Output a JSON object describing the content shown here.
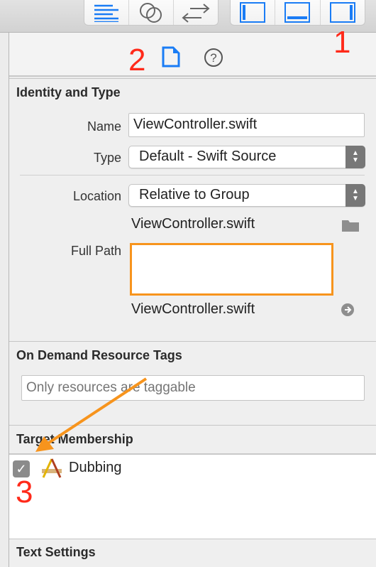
{
  "toolbar": {
    "editor_icons": [
      "align-left-icon",
      "venn-icon",
      "arrows-icon"
    ],
    "panel_icons": [
      "left-panel-icon",
      "bottom-panel-icon",
      "right-panel-icon"
    ]
  },
  "inspector_tabs": [
    "file-inspector-icon",
    "help-icon"
  ],
  "identity": {
    "title": "Identity and Type",
    "name_label": "Name",
    "name_value": "ViewController.swift",
    "type_label": "Type",
    "type_value": "Default - Swift Source",
    "location_label": "Location",
    "location_value": "Relative to Group",
    "location_file": "ViewController.swift",
    "fullpath_label": "Full Path",
    "fullpath_file": "ViewController.swift"
  },
  "odr": {
    "title": "On Demand Resource Tags",
    "placeholder": "Only resources are taggable"
  },
  "target": {
    "title": "Target Membership",
    "items": [
      {
        "label": "Dubbing",
        "checked": true
      }
    ]
  },
  "text_settings": {
    "title": "Text Settings"
  },
  "annotations": {
    "n1": "1",
    "n2": "2",
    "n3": "3",
    "color_red": "#ff2a1a",
    "color_orange": "#f7941d"
  },
  "colors": {
    "accent": "#1a7cf5"
  }
}
